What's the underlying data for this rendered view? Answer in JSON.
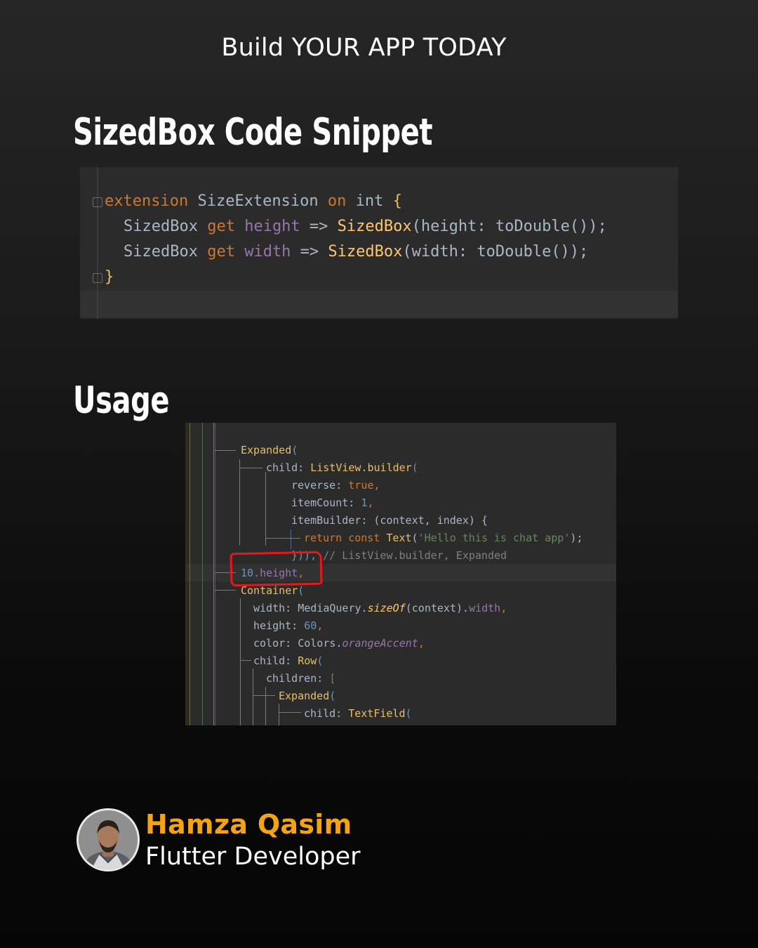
{
  "header": {
    "tagline": "Build YOUR  APP TODAY"
  },
  "section_snippet": {
    "title": "SizedBox Code Snippet",
    "code": {
      "line1": {
        "kw1": "extension",
        "name": " SizeExtension ",
        "kw2": "on",
        "type": " int ",
        "brace": "{"
      },
      "line2": {
        "type": "SizedBox ",
        "kw": "get ",
        "prop": "height",
        "arrow": " => ",
        "cls": "SizedBox",
        "rest": "(height: toDouble());"
      },
      "line3": {
        "type": "SizedBox ",
        "kw": "get ",
        "prop": "width",
        "arrow": " => ",
        "cls": "SizedBox",
        "rest": "(width: toDouble());"
      },
      "line4": {
        "brace": "}"
      }
    }
  },
  "section_usage": {
    "title": "Usage",
    "code": {
      "l1": {
        "cls": "Expanded",
        "p": "("
      },
      "l2": {
        "arg": "child: ",
        "cls": "ListView.builder",
        "p": "("
      },
      "l3": {
        "arg": "reverse: ",
        "kw": "true",
        "p": ","
      },
      "l4": {
        "arg": "itemCount: ",
        "num": "1",
        "p": ","
      },
      "l5": {
        "arg": "itemBuilder: ",
        "p": "(context, index) {"
      },
      "l6": {
        "kw": "return const ",
        "cls": "Text",
        "p1": "(",
        "str": "'Hello this is chat app'",
        "p2": ");"
      },
      "l7": {
        "p": "})), ",
        "cmt": "// ListView.builder, Expanded"
      },
      "l8": {
        "num": "10",
        "prop": ".height",
        "p": ","
      },
      "l9": {
        "cls": "Container",
        "p": "("
      },
      "l10": {
        "arg": "width: ",
        "cls": "MediaQuery.",
        "fn": "sizeOf",
        "p": "(context).",
        "prop": "width",
        "p2": ","
      },
      "l11": {
        "arg": "height: ",
        "num": "60",
        "p": ","
      },
      "l12": {
        "arg": "color: ",
        "cls": "Colors.",
        "prop": "orangeAccent",
        "p": ","
      },
      "l13": {
        "arg": "child: ",
        "cls": "Row",
        "p": "("
      },
      "l14": {
        "arg": "children: ",
        "p": "["
      },
      "l15": {
        "cls": "Expanded",
        "p": "("
      },
      "l16": {
        "arg": "child: ",
        "cls": "TextField",
        "p": "("
      }
    }
  },
  "author": {
    "name": "Hamza Qasim",
    "role": "Flutter Developer",
    "avatar_icon": "person-avatar-icon"
  },
  "colors": {
    "accent": "#f5a316",
    "highlight": "#e01b1b",
    "code_bg": "#2b2b2b"
  }
}
